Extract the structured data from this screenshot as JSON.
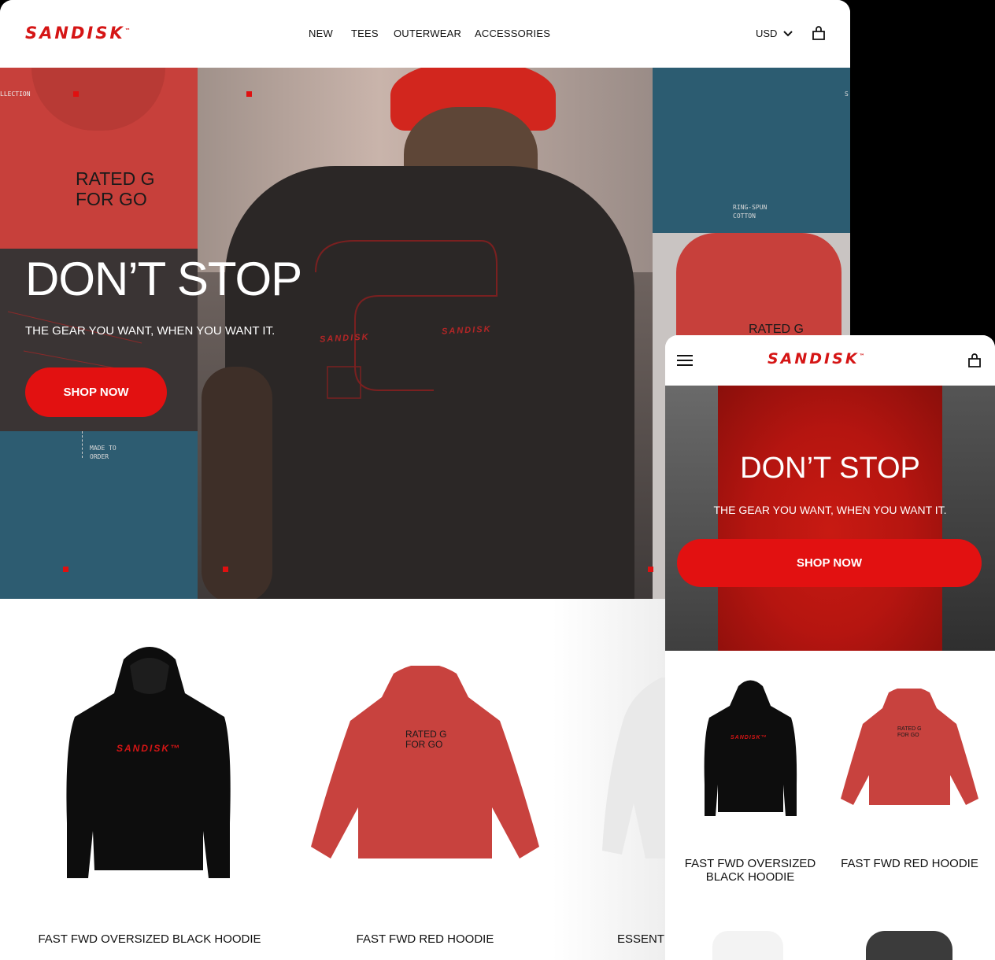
{
  "brand": {
    "name": "SANDISK",
    "tm": "™"
  },
  "desktop": {
    "nav": [
      "NEW",
      "TEES",
      "OUTERWEAR",
      "ACCESSORIES"
    ],
    "currency": "USD",
    "hero": {
      "title": "DON’T STOP",
      "subtitle": "THE GEAR YOU WANT, WHEN YOU WANT IT.",
      "cta": "SHOP NOW",
      "print_tl": "RATED G\nFOR GO",
      "print_tr": "RATED G",
      "label_collection": "LLECTION",
      "label_cotton": "RING-SPUN\nCOTTON",
      "label_order": "MADE TO\nORDER",
      "shirt_logo": "SANDISK",
      "shirt_logo2": "SANDISK",
      "label_s": "S"
    },
    "products": [
      {
        "name": "FAST FWD OVERSIZED BLACK HOODIE",
        "print": "SANDISK™"
      },
      {
        "name": "FAST FWD RED HOODIE",
        "print": "RATED G\nFOR GO"
      },
      {
        "name": "ESSENTI"
      }
    ]
  },
  "mobile": {
    "hero": {
      "title": "DON’T STOP",
      "subtitle": "THE GEAR YOU WANT, WHEN YOU WANT IT.",
      "cta": "SHOP NOW"
    },
    "products": [
      {
        "name": "FAST FWD OVERSIZED BLACK HOODIE",
        "print": "SANDISK™"
      },
      {
        "name": "FAST FWD RED HOODIE",
        "print": "RATED G\nFOR GO"
      }
    ]
  },
  "colors": {
    "brand_red": "#d51515",
    "button_red": "#e21111"
  },
  "icons": [
    "bag-icon",
    "chevron-down-icon",
    "hamburger-menu-icon"
  ]
}
